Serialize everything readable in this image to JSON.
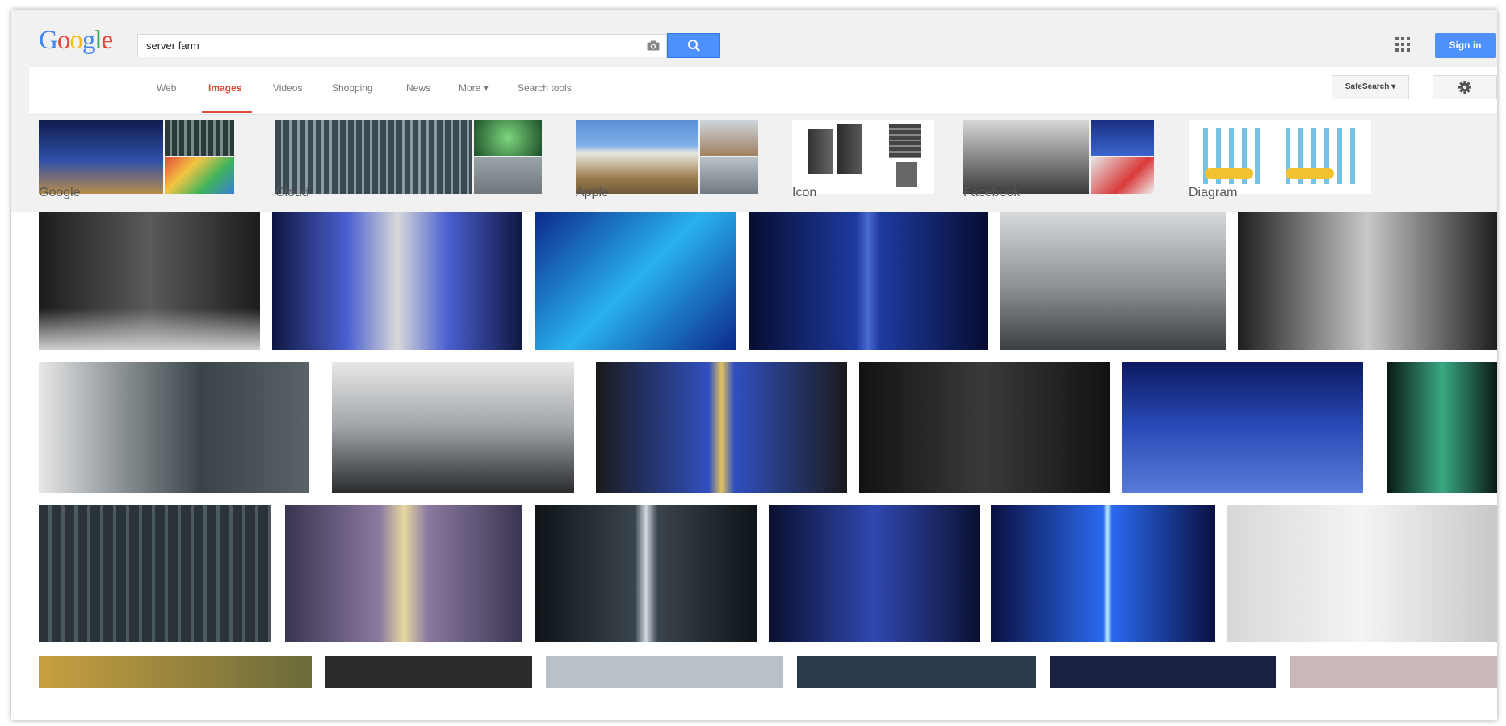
{
  "logo": {
    "text": "Google"
  },
  "search": {
    "query": "server farm"
  },
  "header": {
    "signin_label": "Sign in"
  },
  "nav": {
    "tabs": [
      "Web",
      "Images",
      "Videos",
      "Shopping",
      "News",
      "More ▾",
      "Search tools"
    ],
    "active_tab": "Images",
    "safesearch_label": "SafeSearch ▾"
  },
  "related": [
    {
      "label": "Google"
    },
    {
      "label": "Cloud"
    },
    {
      "label": "Apple"
    },
    {
      "label": "Icon"
    },
    {
      "label": "Facebook"
    },
    {
      "label": "Diagram"
    }
  ],
  "colors": {
    "accent": "#4d90fe",
    "active_tab": "#dd4b39",
    "link": "#777777"
  },
  "icons": {
    "search": "search-icon",
    "camera": "camera-icon",
    "apps": "apps-grid-icon",
    "settings": "gear-icon"
  }
}
